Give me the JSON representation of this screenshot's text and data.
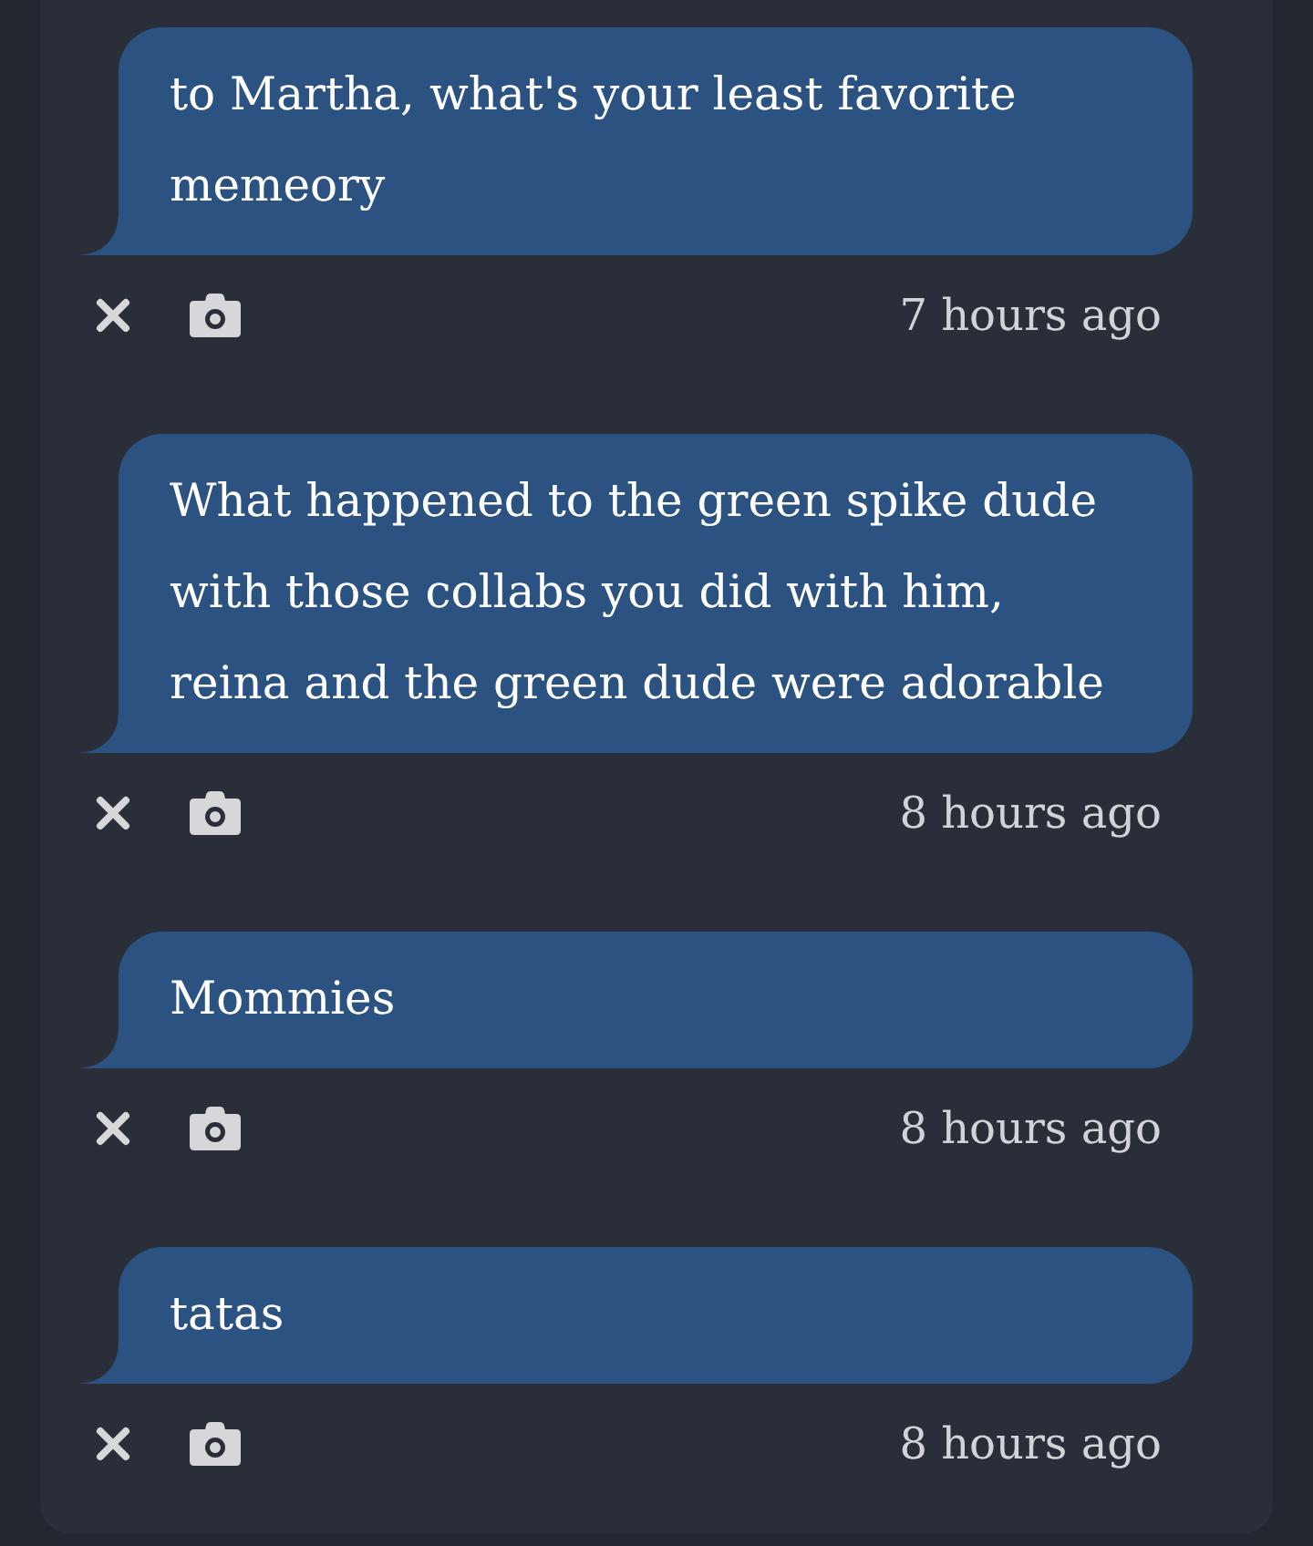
{
  "messages": [
    {
      "text": "to Martha, what's your least favorite memeory",
      "time": "7 hours ago"
    },
    {
      "text": "What happened to the green spike dude with those collabs you did with him, reina and the green dude were adorable",
      "time": "8 hours ago"
    },
    {
      "text": "Mommies",
      "time": "8 hours ago"
    },
    {
      "text": "tatas",
      "time": "8 hours ago"
    }
  ]
}
